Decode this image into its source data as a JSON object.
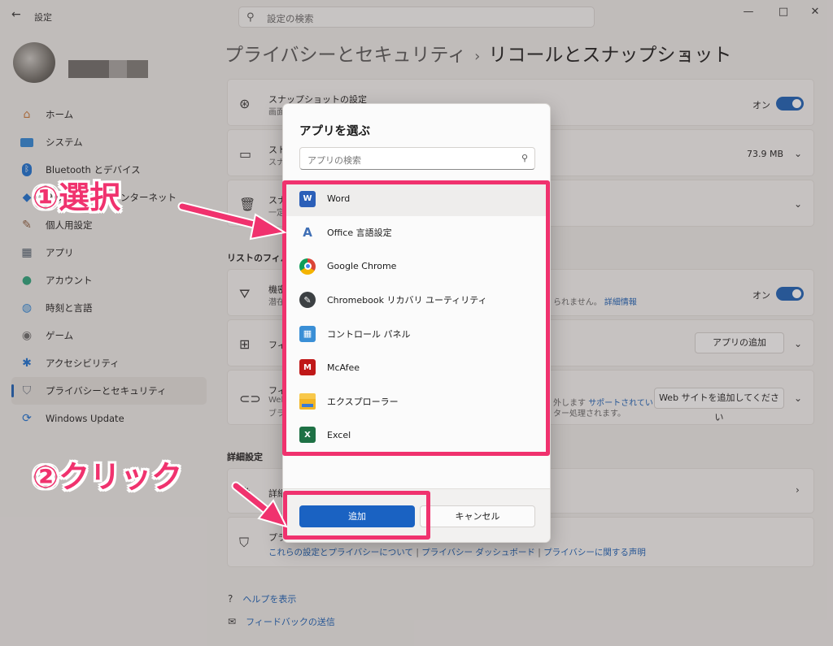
{
  "window": {
    "app_title": "設定",
    "search_placeholder": "設定の検索",
    "minimize": "—",
    "maximize": "□",
    "close": "✕"
  },
  "breadcrumb": {
    "parent": "プライバシーとセキュリティ",
    "separator": "›",
    "current": "リコールとスナップショット"
  },
  "sidebar": {
    "items": [
      {
        "label": "ホーム",
        "icon": "home-icon"
      },
      {
        "label": "システム",
        "icon": "system-icon"
      },
      {
        "label": "Bluetooth とデバイス",
        "icon": "bluetooth-icon"
      },
      {
        "label": "ネットワークとインターネット",
        "icon": "wifi-icon"
      },
      {
        "label": "個人用設定",
        "icon": "brush-icon"
      },
      {
        "label": "アプリ",
        "icon": "apps-icon"
      },
      {
        "label": "アカウント",
        "icon": "account-icon"
      },
      {
        "label": "時刻と言語",
        "icon": "globe-clock-icon"
      },
      {
        "label": "ゲーム",
        "icon": "gamepad-icon"
      },
      {
        "label": "アクセシビリティ",
        "icon": "accessibility-icon"
      },
      {
        "label": "プライバシーとセキュリティ",
        "icon": "shield-icon"
      },
      {
        "label": "Windows Update",
        "icon": "update-icon"
      }
    ]
  },
  "main": {
    "snapshot_card": {
      "title": "スナップショットの設定",
      "sub": "画面",
      "state": "オン"
    },
    "storage_card": {
      "title": "スト",
      "sub": "スナ",
      "size": "73.9 MB"
    },
    "delete_card": {
      "title": "スナ",
      "sub": "一定"
    },
    "filter_section": "リストのフィルタ",
    "sensitive_card": {
      "title": "機密",
      "sub": "潜在",
      "sub_right": "られません。",
      "link": "詳細情報",
      "state": "オン"
    },
    "apps_filter_card": {
      "title": "フィ",
      "button": "アプリの追加"
    },
    "web_filter_card": {
      "title": "フィ",
      "sub1": "Web",
      "sub2": "ブラ",
      "sub_right1": "外します",
      "link": "サポートされている",
      "sub_right2": "ター処理されます。",
      "button": "Web サイトを追加してください"
    },
    "advanced_section": "詳細設定",
    "advanced_card": {
      "title": "詳細"
    },
    "privacy_card": {
      "title": "プラ",
      "links": [
        "これらの設定とプライバシーについて",
        "プライバシー ダッシュボード",
        "プライバシーに関する声明"
      ],
      "link_sep": "|"
    },
    "help": "ヘルプを表示",
    "feedback": "フィードバックの送信"
  },
  "dialog": {
    "title": "アプリを選ぶ",
    "search_placeholder": "アプリの検索",
    "apps": [
      {
        "name": "Word",
        "icon": "word-icon",
        "color": "#2b5fb8",
        "glyph": "W"
      },
      {
        "name": "Office 言語設定",
        "icon": "office-language-icon",
        "color": "#5b86c7",
        "glyph": "A"
      },
      {
        "name": "Google Chrome",
        "icon": "chrome-icon",
        "color": "#db4437",
        "glyph": ""
      },
      {
        "name": "Chromebook リカバリ ユーティリティ",
        "icon": "chromebook-recovery-icon",
        "color": "#3c4043",
        "glyph": "🔧"
      },
      {
        "name": "コントロール パネル",
        "icon": "control-panel-icon",
        "color": "#3a8fd6",
        "glyph": "▦"
      },
      {
        "name": "McAfee",
        "icon": "mcafee-icon",
        "color": "#c01818",
        "glyph": "M"
      },
      {
        "name": "エクスプローラー",
        "icon": "file-explorer-icon",
        "color": "#f2b526",
        "glyph": ""
      },
      {
        "name": "Excel",
        "icon": "excel-icon",
        "color": "#1e7145",
        "glyph": "X"
      }
    ],
    "add_button": "追加",
    "cancel_button": "キャンセル"
  },
  "annotations": {
    "step1": "①選択",
    "step2": "②クリック",
    "color": "#f0326e"
  }
}
